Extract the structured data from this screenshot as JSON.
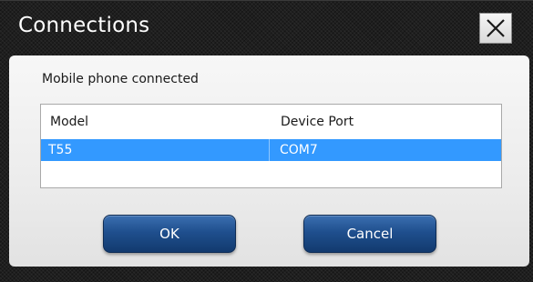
{
  "dialog": {
    "title": "Connections",
    "close_icon": "close-icon"
  },
  "status": {
    "text": "Mobile phone connected"
  },
  "table": {
    "columns": [
      "Model",
      "Device Port"
    ],
    "rows": [
      {
        "model": "T55",
        "port": "COM7",
        "selected": true
      }
    ],
    "selection_color": "#3399ff"
  },
  "buttons": {
    "ok_label": "OK",
    "cancel_label": "Cancel",
    "color": "#1f4f8e"
  }
}
